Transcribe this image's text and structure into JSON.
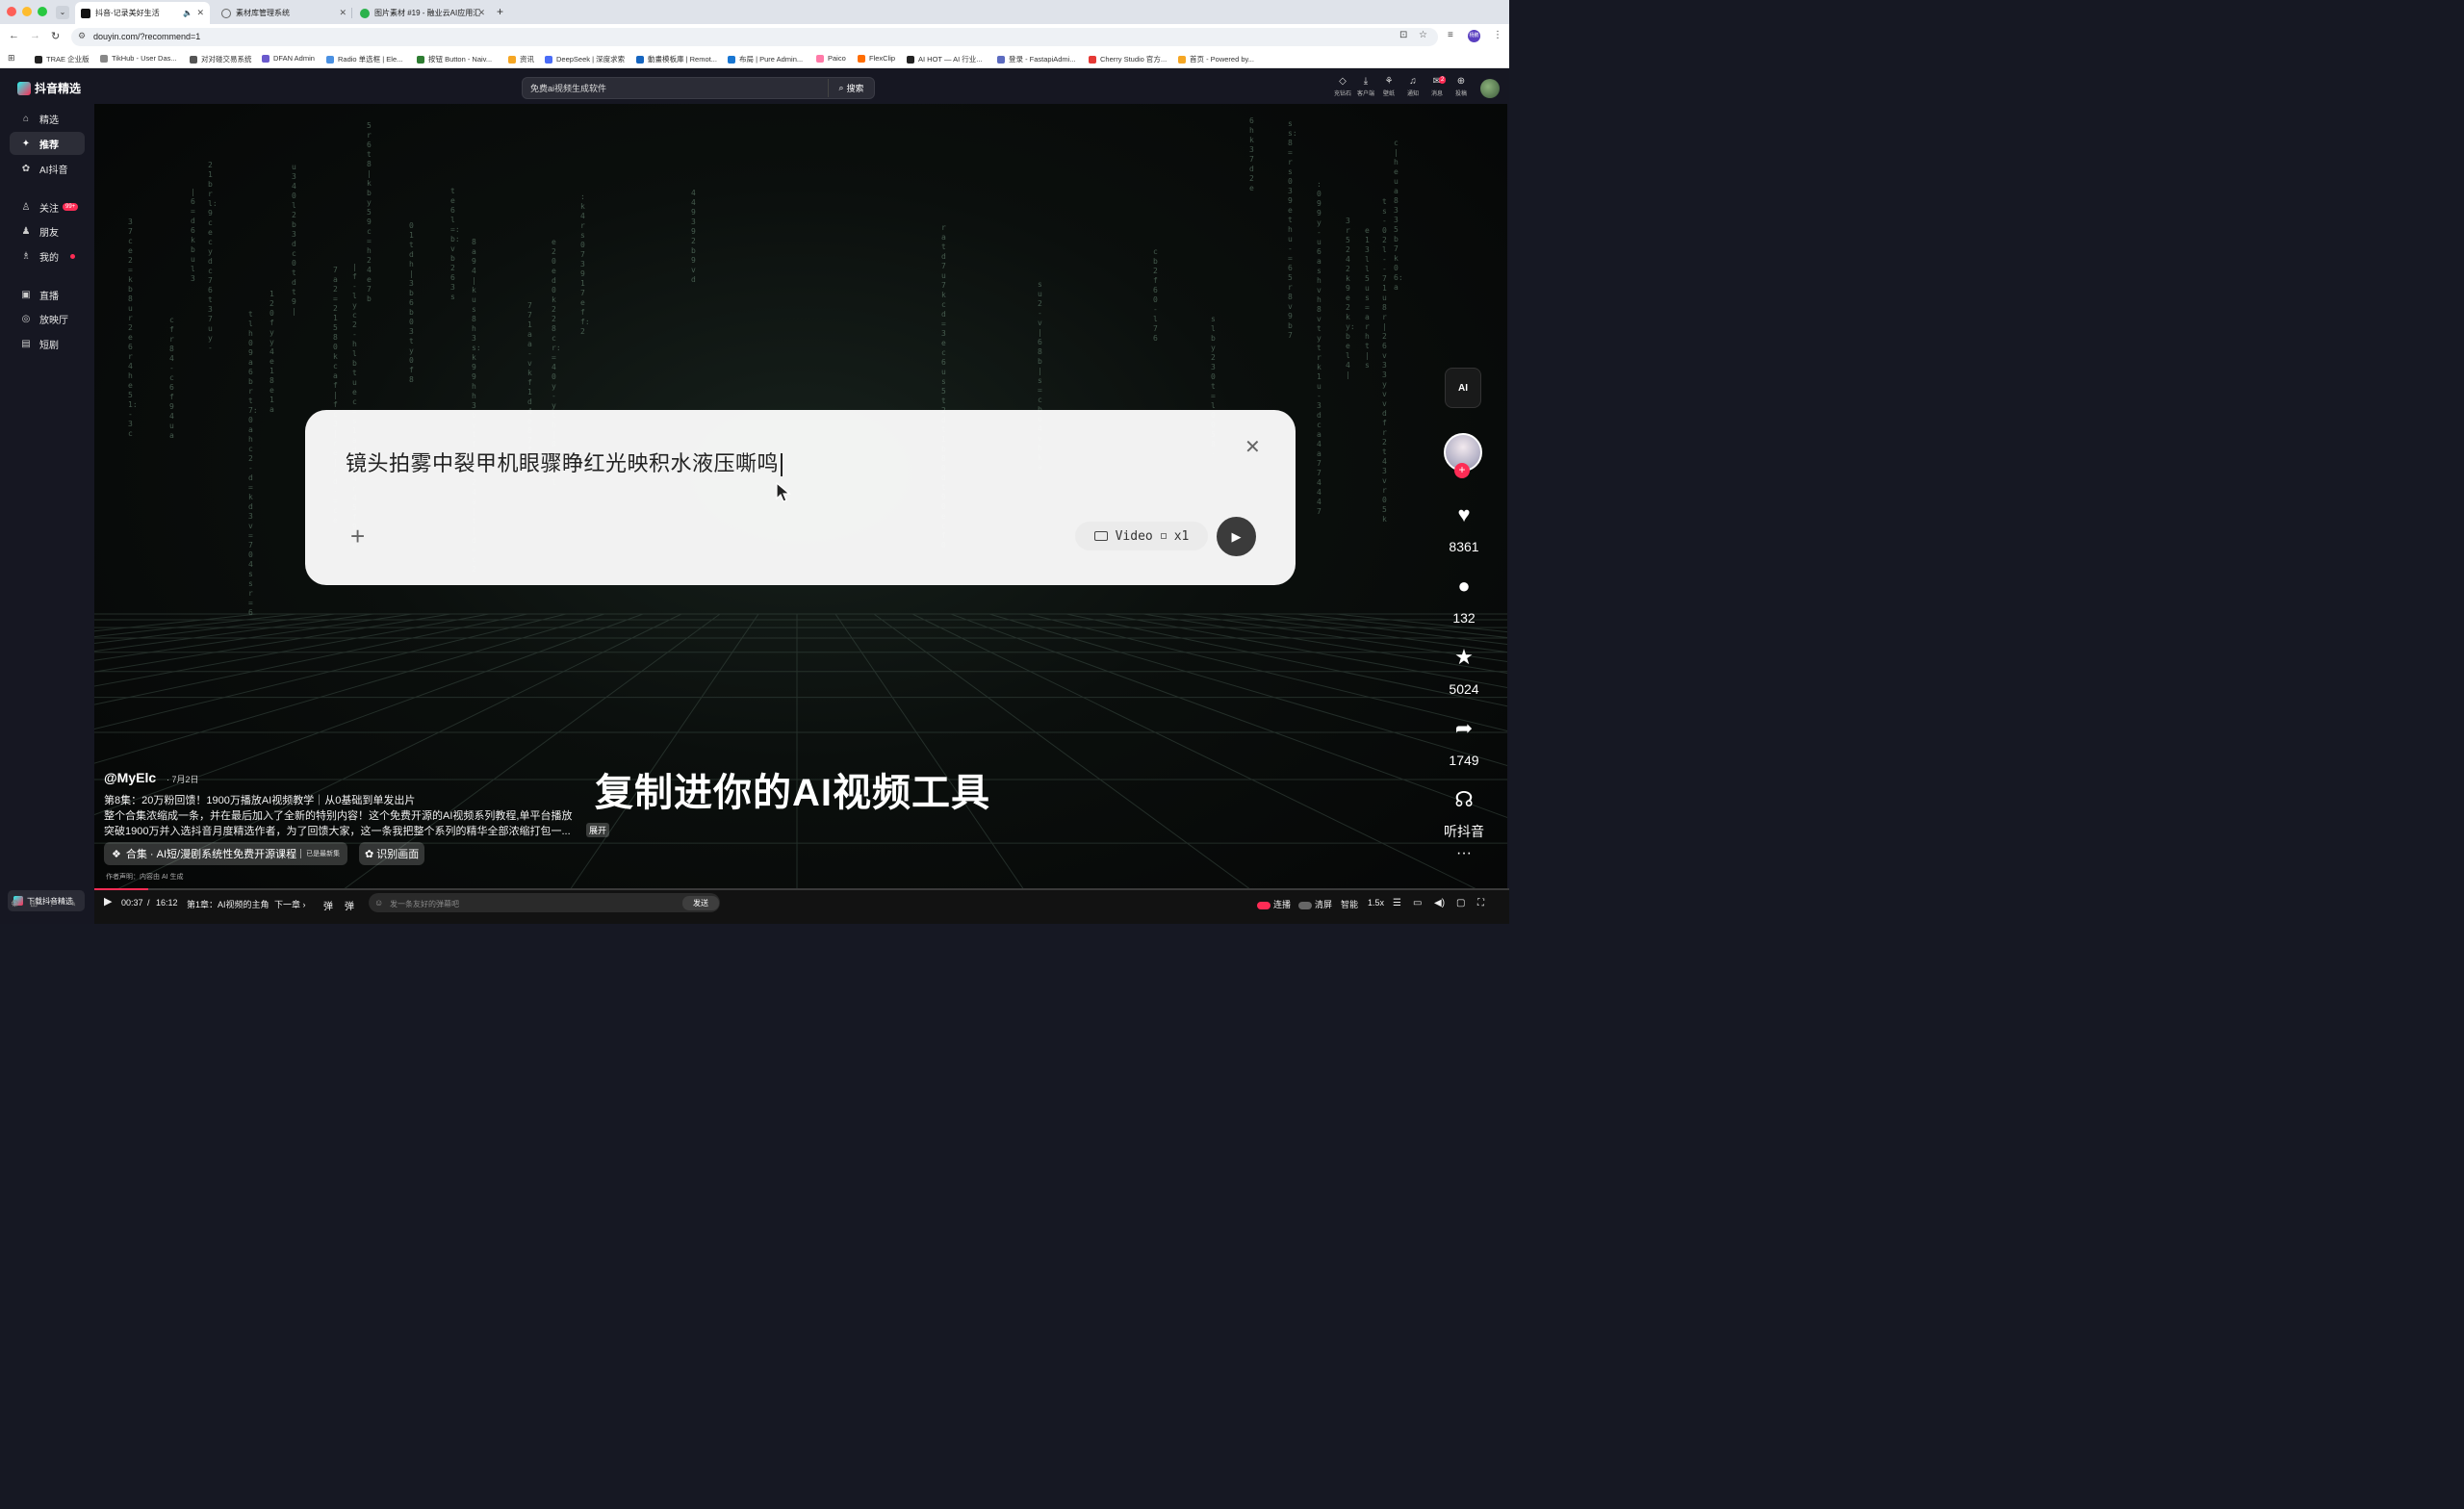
{
  "browser": {
    "tabs": [
      {
        "title": "抖音-记录美好生活",
        "active": true,
        "favicon": "douyin-icon"
      },
      {
        "title": "素材库管理系统",
        "active": false,
        "favicon": "globe-icon"
      },
      {
        "title": "图片素材 #19 - 融业云AI应用汇",
        "active": false,
        "favicon": "wechat-icon"
      }
    ],
    "url": "douyin.com/?recommend=1",
    "bookmarks": [
      "TRAE 企业版",
      "TikHub - User Das...",
      "对对碰交易系统",
      "DFAN Admin",
      "Radio 单选框 | Ele...",
      "按钮 Button - Naiv...",
      "资讯",
      "DeepSeek | 深度求索",
      "動畫模板庫 | Remot...",
      "布局 | Pure Admin...",
      "Paico",
      "FlexClip",
      "AI HOT — AI 行业...",
      "登录 - FastapiAdmi...",
      "Cherry Studio 官方...",
      "首页 - Powered by..."
    ],
    "profile_label": "杨鹏"
  },
  "app": {
    "logo_text": "抖音精选",
    "search": {
      "value": "免费ai视频生成软件",
      "button_label": "搜索"
    },
    "top_icons": [
      {
        "label": "充钻石",
        "icon": "diamond-icon"
      },
      {
        "label": "客户端",
        "icon": "download-icon"
      },
      {
        "label": "壁纸",
        "icon": "wallpaper-icon"
      },
      {
        "label": "通知",
        "icon": "bell-icon"
      },
      {
        "label": "消息",
        "icon": "message-icon",
        "badge": "2"
      },
      {
        "label": "投稿",
        "icon": "upload-icon"
      }
    ],
    "sidebar": {
      "items": [
        {
          "label": "精选",
          "icon": "home-icon"
        },
        {
          "label": "推荐",
          "icon": "sparkle-icon",
          "active": true
        },
        {
          "label": "AI抖音",
          "icon": "ai-icon"
        },
        {
          "label": "关注",
          "icon": "follow-icon",
          "badge": "99+"
        },
        {
          "label": "朋友",
          "icon": "friends-icon"
        },
        {
          "label": "我的",
          "icon": "user-icon",
          "dot": true
        },
        {
          "label": "直播",
          "icon": "live-icon"
        },
        {
          "label": "放映厅",
          "icon": "cinema-icon"
        },
        {
          "label": "短剧",
          "icon": "drama-icon"
        }
      ],
      "download_label": "下载抖音精选"
    },
    "video": {
      "prompt_text": "镜头拍雾中裂甲机眼骤睁红光映积水液压嘶鸣",
      "pill_mode": "Video",
      "pill_count": "x1",
      "subtitle": "复制进你的AI视频工具",
      "author": "@MyElc",
      "date": "· 7月2日",
      "desc_line1": "第8集：20万粉回馈！1900万播放AI视频教学｜从0基础到单发出片",
      "desc_line2": "整个合集浓缩成一条，并在最后加入了全新的特别内容！这个免费开源的AI视频系列教程,单平台播放",
      "desc_line3": "突破1900万并入选抖音月度精选作者，为了回馈大家，这一条我把整个系列的精华全部浓缩打包一...",
      "expand_label": "展开",
      "collection_label": "合集 · AI短/漫剧系统性免费开源课程",
      "collection_update": "已是最新集",
      "identify_label": "识别画面",
      "ai_note": "作者声明：内容由 AI 生成",
      "ai_button": "AI"
    },
    "rail": {
      "likes": "8361",
      "comments": "132",
      "favorites": "5024",
      "shares": "1749",
      "listen_label": "听抖音"
    },
    "controls": {
      "current_time": "00:37",
      "separator": "/",
      "total_time": "16:12",
      "progress": 0.038,
      "chapter": "第1章：AI视频的主角",
      "next_chapter": "下一章",
      "danmaku_placeholder": "发一条友好的弹幕吧",
      "send_label": "发送",
      "autoplay_label": "连播",
      "clear_label": "清屏",
      "quality_label": "智能",
      "speed_label": "1.5x"
    }
  },
  "colors": {
    "accent": "#fe2c55",
    "bg": "#161722",
    "card": "#fafafa"
  }
}
